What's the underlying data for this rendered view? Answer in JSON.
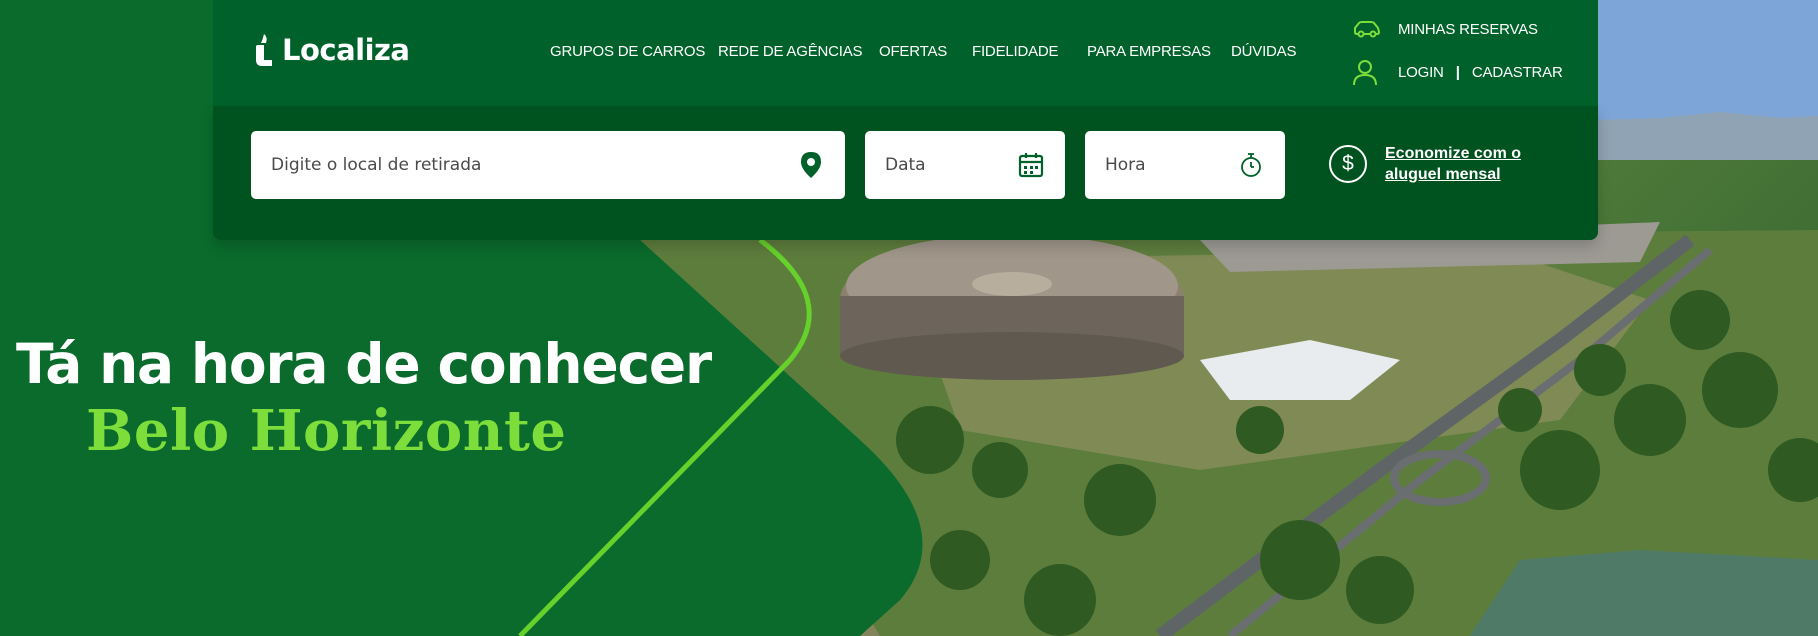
{
  "brand": {
    "logo_text": "Localiza",
    "primary_green": "#00622a",
    "dark_green": "#00521f",
    "accent_lime": "#7ddd3a"
  },
  "nav": {
    "items": [
      {
        "label": "GRUPOS DE CARROS"
      },
      {
        "label": "REDE DE AGÊNCIAS"
      },
      {
        "label": "OFERTAS"
      },
      {
        "label": "FIDELIDADE"
      },
      {
        "label": "PARA EMPRESAS"
      },
      {
        "label": "DÚVIDAS"
      }
    ]
  },
  "account": {
    "reservations_label": "MINHAS RESERVAS",
    "reservations_icon": "car-icon",
    "login_label": "LOGIN",
    "separator": "|",
    "register_label": "CADASTRAR",
    "user_icon": "user-icon"
  },
  "search": {
    "location_placeholder": "Digite o local de retirada",
    "location_icon": "map-pin-icon",
    "date_placeholder": "Data",
    "date_icon": "calendar-icon",
    "time_placeholder": "Hora",
    "time_icon": "stopwatch-icon"
  },
  "promo": {
    "icon": "dollar-circle-icon",
    "symbol": "$",
    "text": "Economize com o aluguel mensal"
  },
  "hero": {
    "headline": "Tá na hora de conhecer",
    "city": "Belo Horizonte"
  }
}
